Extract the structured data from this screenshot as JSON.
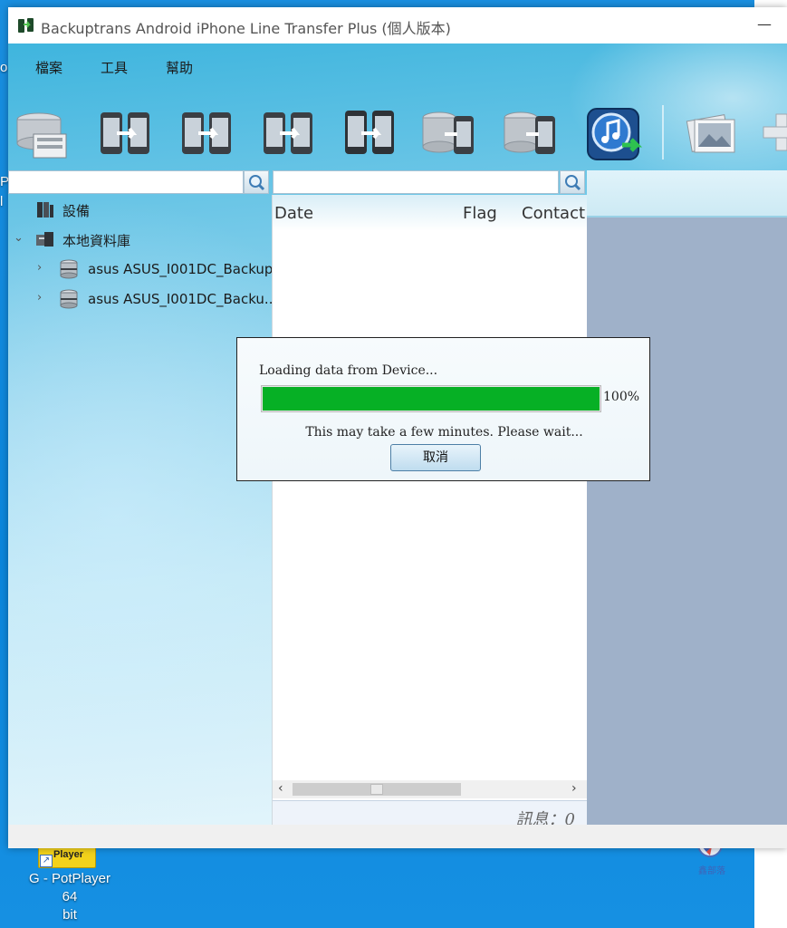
{
  "window": {
    "title": "Backuptrans Android iPhone Line Transfer Plus (個人版本)",
    "minimize": "—"
  },
  "menu": {
    "items": [
      "檔案",
      "工具",
      "幫助"
    ]
  },
  "toolbar": {
    "buttons": [
      "backup-icon",
      "phone-transfer-icon",
      "phone-transfer-icon",
      "phone-transfer-icon",
      "phone-transfer-icon",
      "database-phone-icon",
      "database-phone-icon",
      "itunes-transfer-icon",
      "photos-icon"
    ]
  },
  "tree": {
    "device": "設備",
    "local_db": "本地資料庫",
    "backups": [
      "asus ASUS_I001DC_Backup",
      "asus ASUS_I001DC_Backu..."
    ]
  },
  "list": {
    "columns": [
      "Date",
      "Flag",
      "Contact"
    ],
    "message_count": "訊息：0"
  },
  "dialog": {
    "message": "Loading data from Device...",
    "progress": 1.0,
    "progress_text": "100%",
    "note": "This may take a few minutes. Please wait...",
    "cancel_label": "取消"
  },
  "desktop": {
    "potplayer_badge": "Player",
    "potplayer_label": "G -  PotPlayer 64\nbit",
    "fragments": [
      "o",
      "Pu",
      "l"
    ]
  },
  "watermark": "鑫部落",
  "colors": {
    "progress_fill": "#06b025",
    "desktop_bg": "#0b86dc",
    "right_panel": "#9fb1c9"
  }
}
